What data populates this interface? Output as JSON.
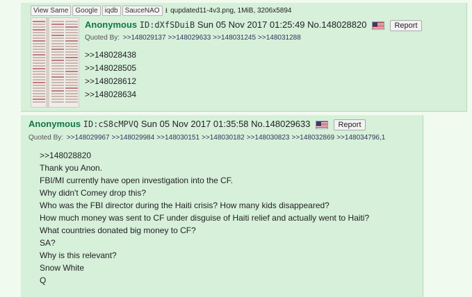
{
  "post1": {
    "file_buttons": [
      "View Same",
      "Google",
      "iqdb",
      "SauceNAO"
    ],
    "file_info": "qupdated11-4v3.png, 1MiB, 3206x5894",
    "name": "Anonymous",
    "id": "ID:dXfSDuiB",
    "datetime": "Sun 05 Nov 2017 01:25:49",
    "number": "No.148028820",
    "report_label": "Report",
    "quoted_by_label": "Quoted By:",
    "quoted_by": [
      ">>148029137",
      ">>148029633",
      ">>148031245",
      ">>148031288"
    ],
    "body": [
      ">>148028438",
      ">>148028505",
      ">>148028612",
      ">>148028634"
    ]
  },
  "post2": {
    "name": "Anonymous",
    "id": "ID:cS8cMPVQ",
    "datetime": "Sun 05 Nov 2017 01:35:58",
    "number": "No.148029633",
    "report_label": "Report",
    "quoted_by_label": "Quoted By:",
    "quoted_by": [
      ">>148029967",
      ">>148029984",
      ">>148030151",
      ">>148030182",
      ">>148030823",
      ">>148032869",
      ">>148034796,1"
    ],
    "body": [
      ">>148028820",
      "Thank you Anon.",
      "FBI/MI currently have open investigation into the CF.",
      "Why didn't Comey drop this?",
      "Who was the FBI director during the Haiti crisis? How many kids disappeared?",
      "How much money was sent to CF under disguise of Haiti relief and actually went to Haiti?",
      "What countries donated big money to CF?",
      "SA?",
      "Why is this relevant?",
      "Snow White",
      "Q"
    ]
  },
  "icons": {
    "download": "download-icon",
    "flag": "us-flag-icon"
  }
}
